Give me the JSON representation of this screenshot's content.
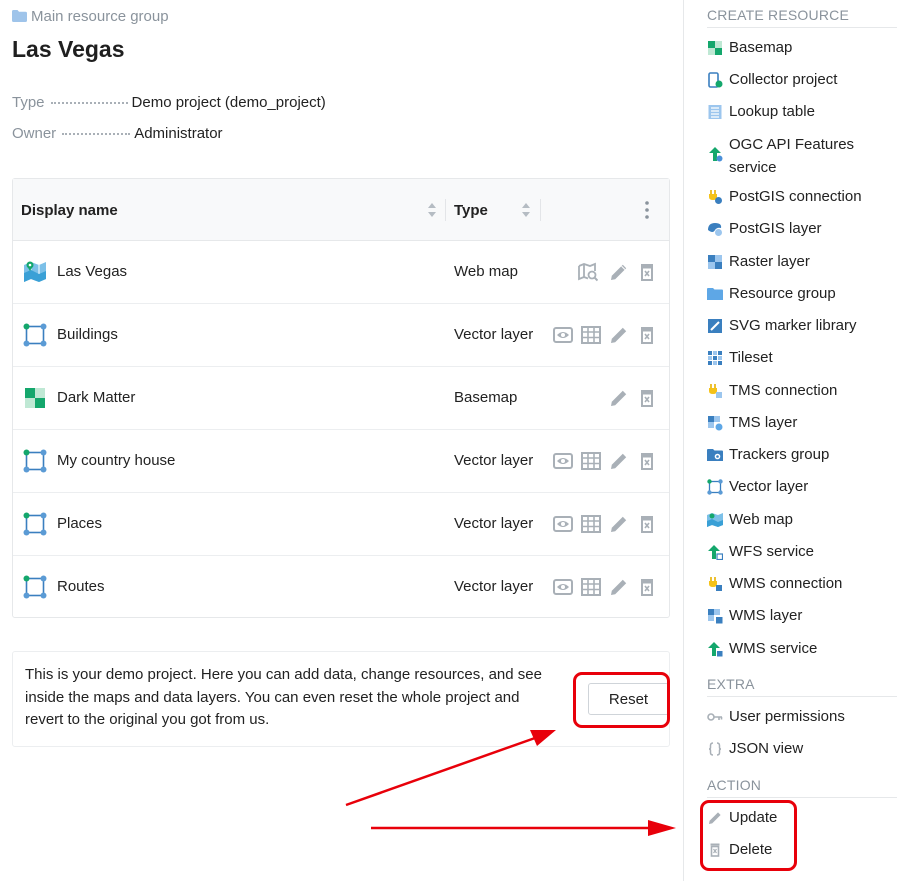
{
  "breadcrumb": "Main resource group",
  "title": "Las Vegas",
  "meta": {
    "type_key": "Type",
    "type_value": "Demo project (demo_project)",
    "owner_key": "Owner",
    "owner_value": "Administrator"
  },
  "table": {
    "col_name": "Display name",
    "col_type": "Type",
    "rows": [
      {
        "name": "Las Vegas",
        "type": "Web map"
      },
      {
        "name": "Buildings",
        "type": "Vector layer"
      },
      {
        "name": "Dark Matter",
        "type": "Basemap"
      },
      {
        "name": "My country house",
        "type": "Vector layer"
      },
      {
        "name": "Places",
        "type": "Vector layer"
      },
      {
        "name": "Routes",
        "type": "Vector layer"
      }
    ]
  },
  "notice": {
    "text": "This is your demo project. Here you can add data, change resources, and see inside the maps and data layers. You can even reset the whole project and revert to the original you got from us.",
    "reset_label": "Reset"
  },
  "sidebar": {
    "create_heading": "CREATE RESOURCE",
    "create_items": [
      {
        "label": "Basemap",
        "icon": "basemap-icon"
      },
      {
        "label": "Collector project",
        "icon": "collector-project-icon"
      },
      {
        "label": "Lookup table",
        "icon": "lookup-table-icon"
      },
      {
        "label": "OGC API Features service",
        "icon": "ogc-service-icon"
      },
      {
        "label": "PostGIS connection",
        "icon": "postgis-connection-icon"
      },
      {
        "label": "PostGIS layer",
        "icon": "postgis-layer-icon"
      },
      {
        "label": "Raster layer",
        "icon": "raster-layer-icon"
      },
      {
        "label": "Resource group",
        "icon": "folder-icon"
      },
      {
        "label": "SVG marker library",
        "icon": "svg-marker-library-icon"
      },
      {
        "label": "Tileset",
        "icon": "tileset-icon"
      },
      {
        "label": "TMS connection",
        "icon": "tms-connection-icon"
      },
      {
        "label": "TMS layer",
        "icon": "tms-layer-icon"
      },
      {
        "label": "Trackers group",
        "icon": "trackers-group-icon"
      },
      {
        "label": "Vector layer",
        "icon": "vector-layer-icon"
      },
      {
        "label": "Web map",
        "icon": "web-map-icon"
      },
      {
        "label": "WFS service",
        "icon": "wfs-service-icon"
      },
      {
        "label": "WMS connection",
        "icon": "wms-connection-icon"
      },
      {
        "label": "WMS layer",
        "icon": "wms-layer-icon"
      },
      {
        "label": "WMS service",
        "icon": "wms-service-icon"
      }
    ],
    "extra_heading": "EXTRA",
    "extra_items": [
      {
        "label": "User permissions",
        "icon": "key-icon"
      },
      {
        "label": "JSON view",
        "icon": "braces-icon"
      }
    ],
    "action_heading": "ACTION",
    "action_items": [
      {
        "label": "Update",
        "icon": "pencil-icon"
      },
      {
        "label": "Delete",
        "icon": "trash-icon"
      }
    ]
  },
  "colors": {
    "accent_green": "#14a76c",
    "accent_blue": "#4a90d9",
    "muted_text": "#8a939c",
    "highlight_red": "#e8000a"
  }
}
